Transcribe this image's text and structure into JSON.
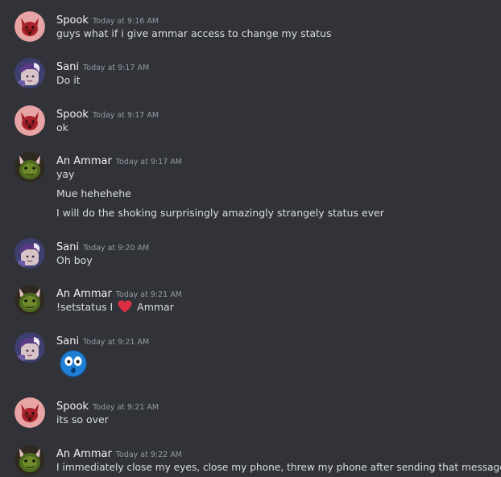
{
  "messages": [
    {
      "author": "Spook",
      "avatar": "red-fox-avatar",
      "time": "Today at 9:16 AM",
      "lines": [
        "guys what if i give ammar access to change my status"
      ]
    },
    {
      "author": "Sani",
      "avatar": "purple-hat-avatar",
      "time": "Today at 9:17 AM",
      "lines": [
        "Do it"
      ]
    },
    {
      "author": "Spook",
      "avatar": "red-fox-avatar",
      "time": "Today at 9:17 AM",
      "lines": [
        "ok"
      ]
    },
    {
      "author": "An Ammar",
      "avatar": "green-cat-avatar",
      "time": "Today at 9:17 AM",
      "lines": [
        "yay",
        "Mue hehehehe",
        "I will do the shoking surprisingly amazingly strangely status ever"
      ]
    },
    {
      "author": "Sani",
      "avatar": "purple-hat-avatar",
      "time": "Today at 9:20 AM",
      "lines": [
        "Oh boy"
      ]
    },
    {
      "author": "An Ammar",
      "avatar": "green-cat-avatar",
      "time": "Today at 9:21 AM",
      "status_before": "!setstatus I",
      "status_emoji": "red-heart-emoji",
      "status_after": "Ammar"
    },
    {
      "author": "Sani",
      "avatar": "purple-hat-avatar",
      "time": "Today at 9:21 AM",
      "emoji": "flushed-face-emoji"
    },
    {
      "author": "Spook",
      "avatar": "red-fox-avatar",
      "time": "Today at 9:21 AM",
      "lines": [
        "its so over"
      ]
    },
    {
      "author": "An Ammar",
      "avatar": "green-cat-avatar",
      "time": "Today at 9:22 AM",
      "lines": [
        "I immediately close my eyes, close my phone, threw my phone after sending that message"
      ]
    }
  ],
  "colors": {
    "background": "#313338",
    "username": "#f2f3f5",
    "timestamp": "#949ba4",
    "text": "#dbdee1",
    "heart": "#dd2e44"
  }
}
